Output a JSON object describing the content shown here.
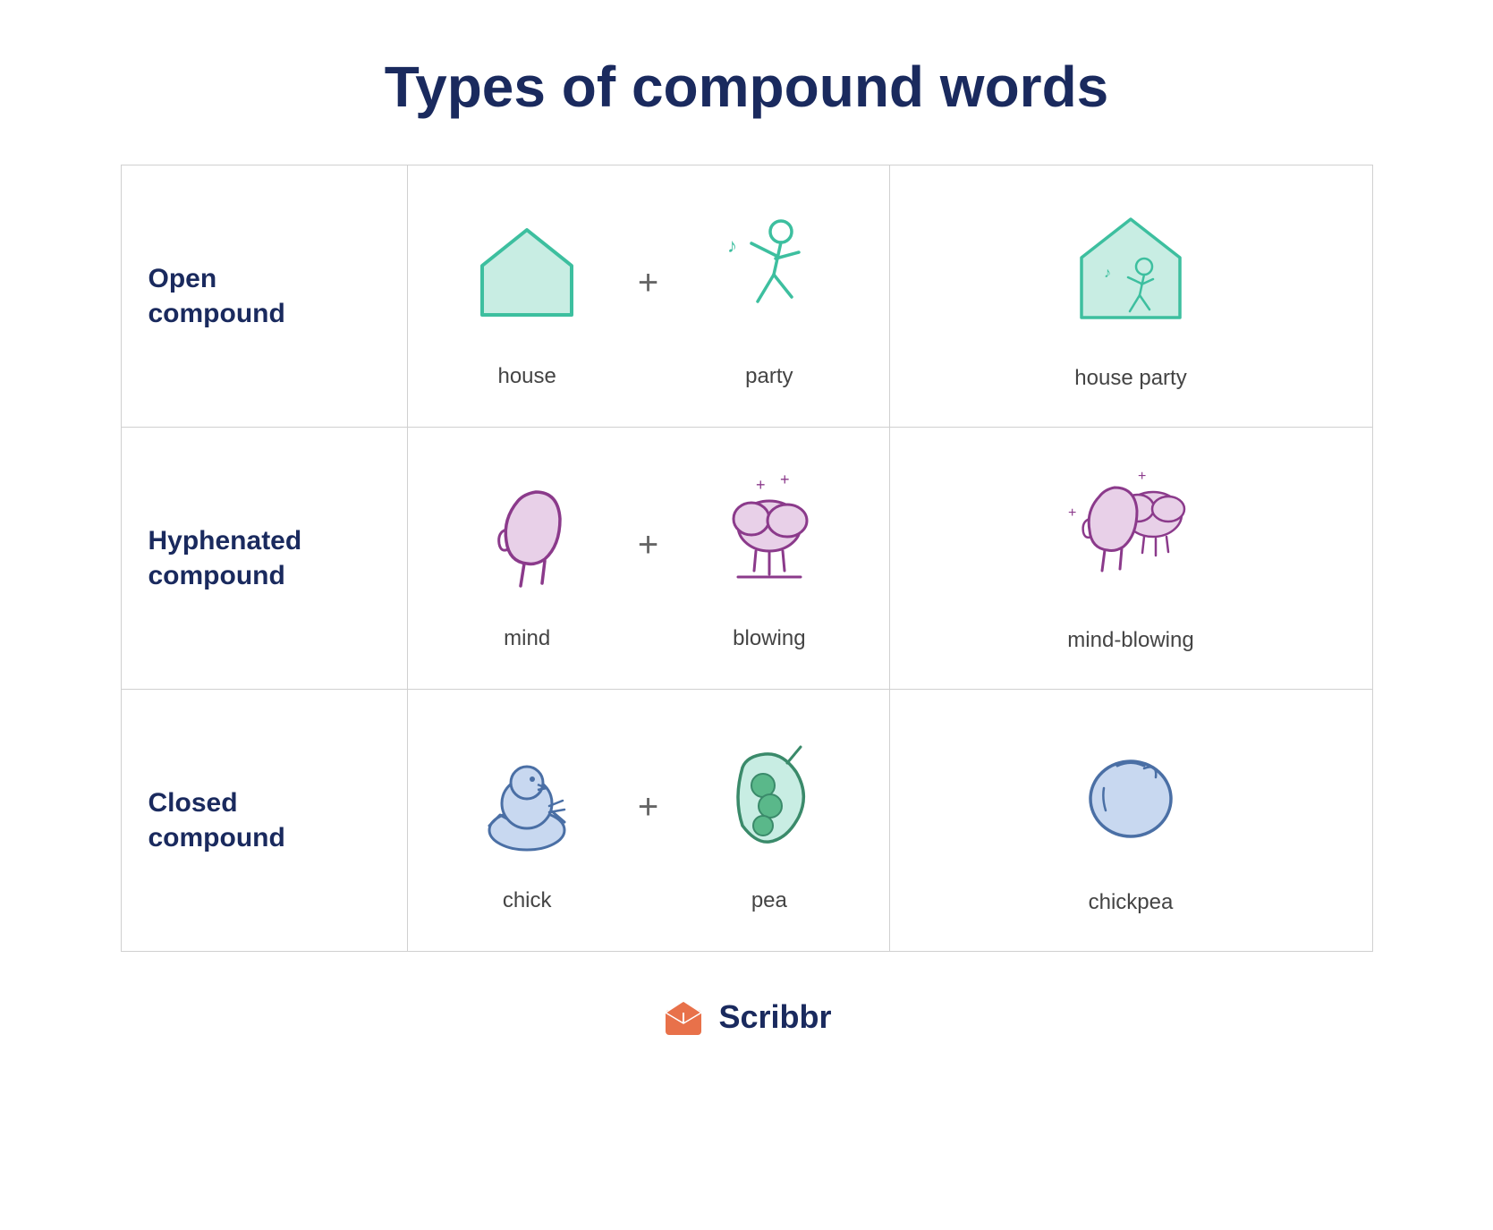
{
  "page": {
    "title": "Types of compound words"
  },
  "rows": [
    {
      "label": "Open\ncompound",
      "word1": "house",
      "word2": "party",
      "result": "house party"
    },
    {
      "label": "Hyphenated\ncompound",
      "word1": "mind",
      "word2": "blowing",
      "result": "mind-blowing"
    },
    {
      "label": "Closed\ncompound",
      "word1": "chick",
      "word2": "pea",
      "result": "chickpea"
    }
  ],
  "footer": {
    "brand": "Scribbr"
  },
  "colors": {
    "teal": "#5ec8b0",
    "teal_fill": "#d0f0e8",
    "purple": "#8b3a8b",
    "purple_light": "#e8d0e8",
    "blue_dark": "#4a6fa5",
    "blue_light": "#c8d8f0",
    "navy": "#1a2a5e",
    "orange": "#e8714a"
  }
}
